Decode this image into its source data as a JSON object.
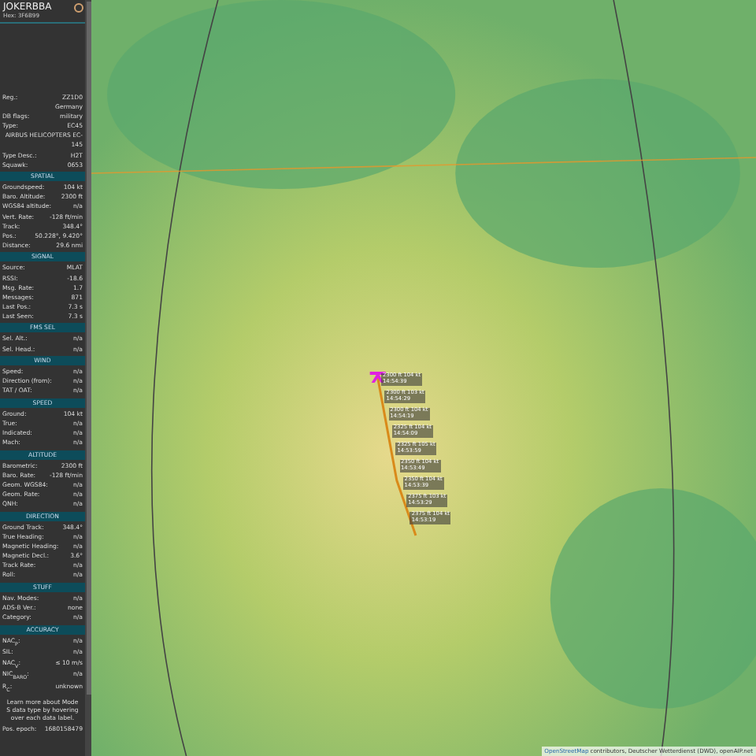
{
  "aircraft": {
    "callsign": "JOKERBBA",
    "hex": "Hex: 3F6B99"
  },
  "info": [
    {
      "label": "Reg.:",
      "value": "ZZ1D0"
    },
    {
      "value": "Germany"
    },
    {
      "label": "DB flags:",
      "value": "military"
    },
    {
      "label": "Type:",
      "value": "EC45"
    },
    {
      "value": "AIRBUS HELICOPTERS EC-145"
    },
    {
      "label": "Type Desc.:",
      "value": "H2T"
    },
    {
      "label": "Squawk:",
      "value": "0653"
    }
  ],
  "sections": [
    {
      "title": "SPATIAL",
      "rows": [
        {
          "label": "Groundspeed:",
          "value": "104 kt"
        },
        {
          "label": "Baro. Altitude:",
          "value": "2300 ft"
        },
        {
          "label": "WGS84 altitude:",
          "value": "n/a"
        },
        {
          "label": "Vert. Rate:",
          "value": "-128 ft/min"
        },
        {
          "label": "Track:",
          "value": "348.4°"
        },
        {
          "label": "Pos.:",
          "value": "50.228°, 9.420°"
        },
        {
          "label": "Distance:",
          "value": "29.6 nmi"
        }
      ]
    },
    {
      "title": "SIGNAL",
      "rows": [
        {
          "label": "Source:",
          "value": "MLAT"
        },
        {
          "label": "RSSI:",
          "value": "-18.6"
        },
        {
          "label": "Msg. Rate:",
          "value": "1.7"
        },
        {
          "label": "Messages:",
          "value": "871"
        },
        {
          "label": "Last Pos.:",
          "value": "7.3 s"
        },
        {
          "label": "Last Seen:",
          "value": "7.3 s"
        }
      ]
    },
    {
      "title": "FMS SEL",
      "rows": [
        {
          "label": "Sel. Alt.:",
          "value": "n/a"
        },
        {
          "label": "Sel. Head.:",
          "value": "n/a"
        }
      ]
    },
    {
      "title": "WIND",
      "rows": [
        {
          "label": "Speed:",
          "value": "n/a"
        },
        {
          "label": "Direction (from):",
          "value": "n/a"
        },
        {
          "label": "TAT / OAT:",
          "value": "n/a"
        }
      ]
    },
    {
      "title": "SPEED",
      "rows": [
        {
          "label": "Ground:",
          "value": "104 kt"
        },
        {
          "label": "True:",
          "value": "n/a"
        },
        {
          "label": "Indicated:",
          "value": "n/a"
        },
        {
          "label": "Mach:",
          "value": "n/a"
        }
      ]
    },
    {
      "title": "ALTITUDE",
      "rows": [
        {
          "label": "Barometric:",
          "value": "2300 ft"
        },
        {
          "label": "Baro. Rate:",
          "value": "-128 ft/min"
        },
        {
          "label": "Geom. WGS84:",
          "value": "n/a"
        },
        {
          "label": "Geom. Rate:",
          "value": "n/a"
        },
        {
          "label": "QNH:",
          "value": "n/a"
        }
      ]
    },
    {
      "title": "DIRECTION",
      "rows": [
        {
          "label": "Ground Track:",
          "value": "348.4°"
        },
        {
          "label": "True Heading:",
          "value": "n/a"
        },
        {
          "label": "Magnetic Heading:",
          "value": "n/a"
        },
        {
          "label": "Magnetic Decl.:",
          "value": "3.6°"
        },
        {
          "label": "Track Rate:",
          "value": "n/a"
        },
        {
          "label": "Roll:",
          "value": "n/a"
        }
      ]
    },
    {
      "title": "STUFF",
      "rows": [
        {
          "label": "Nav. Modes:",
          "value": "n/a"
        },
        {
          "label": "ADS-B Ver.:",
          "value": "none"
        },
        {
          "label": "Category:",
          "value": "n/a"
        }
      ]
    },
    {
      "title": "ACCURACY",
      "rows": [
        {
          "label": "NAC$_{P}$:",
          "value": "n/a"
        },
        {
          "label": "SIL:",
          "value": "n/a"
        },
        {
          "label": "NAC$_{V}$:",
          "value": "≤ 10 m/s"
        },
        {
          "label": "NIC$_{BARO}$:",
          "value": "n/a"
        },
        {
          "label": "R$_{C}$:",
          "value": "unknown"
        }
      ]
    }
  ],
  "note": "Learn more about Mode S data type by hovering over each data label.",
  "epoch": {
    "label": "Pos. epoch:",
    "value": "1680158479"
  },
  "track_labels": [
    {
      "line1": "2300 ft 104 kt",
      "line2": "14:54:39"
    },
    {
      "line1": "2300 ft 103 kt",
      "line2": "14:54:29"
    },
    {
      "line1": "2300 ft 104 kt",
      "line2": "14:54:19"
    },
    {
      "line1": "2325 ft 104 kt",
      "line2": "14:54:09"
    },
    {
      "line1": "2325 ft 105 kt",
      "line2": "14:53:59"
    },
    {
      "line1": "2350 ft 104 kt",
      "line2": "14:53:49"
    },
    {
      "line1": "2350 ft 104 kt",
      "line2": "14:53:39"
    },
    {
      "line1": "2375 ft 103 kt",
      "line2": "14:53:29"
    },
    {
      "line1": "2375 ft 104 kt",
      "line2": "14:53:19"
    }
  ],
  "attribution": {
    "link": "OpenStreetMap",
    "text": "contributors, Deutscher Wetterdienst (DWD), openAIP.net"
  }
}
